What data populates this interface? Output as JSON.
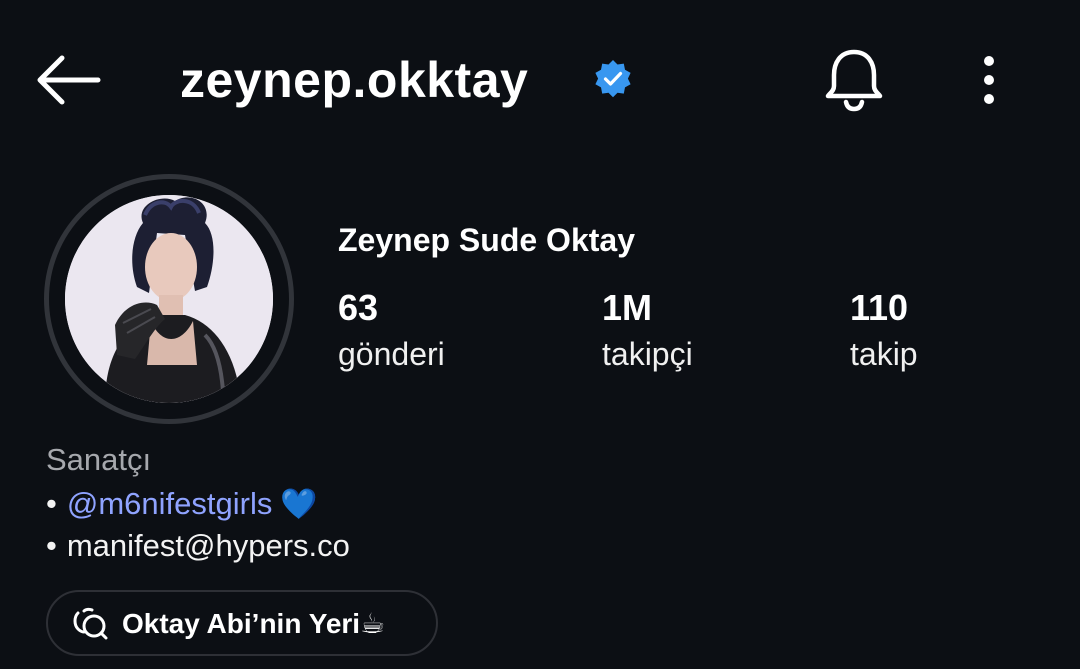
{
  "header": {
    "username": "zeynep.okktay",
    "verified": true,
    "accent_color": "#3897f0"
  },
  "profile": {
    "full_name": "Zeynep Sude Oktay",
    "avatar_alt": "profile picture"
  },
  "stats": {
    "posts": {
      "count": "63",
      "label": "gönderi"
    },
    "followers": {
      "count": "1M",
      "label": "takipçi"
    },
    "following": {
      "count": "110",
      "label": "takip"
    }
  },
  "bio": {
    "category": "Sanatçı",
    "bullet": "•",
    "mention": "@m6nifestgirls",
    "heart": "💙",
    "email": "manifest@hypers.co"
  },
  "threads_link": {
    "label": "Oktay Abi’nin Yeri☕"
  },
  "icons": {
    "back": "arrow-left-icon",
    "verified": "verified-badge-icon",
    "bell": "bell-icon",
    "more": "more-vertical-icon",
    "threads": "threads-icon"
  }
}
